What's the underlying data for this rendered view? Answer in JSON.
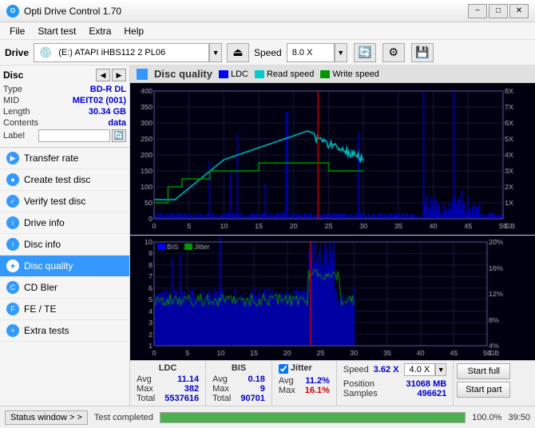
{
  "titlebar": {
    "title": "Opti Drive Control 1.70",
    "min_btn": "−",
    "max_btn": "□",
    "close_btn": "✕"
  },
  "menubar": {
    "items": [
      "File",
      "Start test",
      "Extra",
      "Help"
    ]
  },
  "drivebar": {
    "drive_label": "Drive",
    "drive_value": "(E:)  ATAPI iHBS112  2 PL06",
    "speed_label": "Speed",
    "speed_value": "8.0 X"
  },
  "disc": {
    "title": "Disc",
    "type_label": "Type",
    "type_value": "BD-R DL",
    "mid_label": "MID",
    "mid_value": "MEIT02 (001)",
    "length_label": "Length",
    "length_value": "30.34 GB",
    "contents_label": "Contents",
    "contents_value": "data",
    "label_label": "Label"
  },
  "nav": {
    "items": [
      {
        "id": "transfer-rate",
        "label": "Transfer rate",
        "active": false
      },
      {
        "id": "create-test-disc",
        "label": "Create test disc",
        "active": false
      },
      {
        "id": "verify-test-disc",
        "label": "Verify test disc",
        "active": false
      },
      {
        "id": "drive-info",
        "label": "Drive info",
        "active": false
      },
      {
        "id": "disc-info",
        "label": "Disc info",
        "active": false
      },
      {
        "id": "disc-quality",
        "label": "Disc quality",
        "active": true
      },
      {
        "id": "cd-bler",
        "label": "CD Bler",
        "active": false
      },
      {
        "id": "fe-te",
        "label": "FE / TE",
        "active": false
      },
      {
        "id": "extra-tests",
        "label": "Extra tests",
        "active": false
      }
    ]
  },
  "chart": {
    "title": "Disc quality",
    "legend": [
      {
        "label": "LDC",
        "color": "#0000ff"
      },
      {
        "label": "Read speed",
        "color": "#00cccc"
      },
      {
        "label": "Write speed",
        "color": "#009900"
      }
    ],
    "legend2": [
      {
        "label": "BIS",
        "color": "#0000ff"
      },
      {
        "label": "Jitter",
        "color": "#009900"
      }
    ]
  },
  "stats": {
    "ldc_label": "LDC",
    "bis_label": "BIS",
    "jitter_label": "Jitter",
    "speed_label": "Speed",
    "avg_label": "Avg",
    "max_label": "Max",
    "total_label": "Total",
    "ldc_avg": "11.14",
    "ldc_max": "382",
    "ldc_total": "5537616",
    "bis_avg": "0.18",
    "bis_max": "9",
    "bis_total": "90701",
    "jitter_avg": "11.2%",
    "jitter_max": "16.1%",
    "jitter_checked": true,
    "speed_value": "3.62 X",
    "speed_dropdown": "4.0 X",
    "position_label": "Position",
    "position_value": "31068 MB",
    "samples_label": "Samples",
    "samples_value": "496621",
    "start_full_label": "Start full",
    "start_part_label": "Start part"
  },
  "bottombar": {
    "status_label": "Status window > >",
    "progress": 100,
    "progress_text": "100.0%",
    "time": "39:50",
    "completed_text": "Test completed"
  }
}
